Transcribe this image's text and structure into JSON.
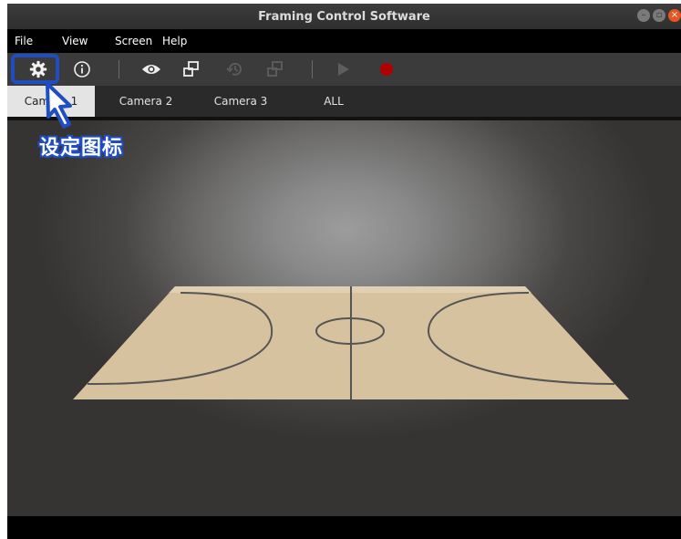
{
  "window": {
    "title": "Framing Control Software"
  },
  "menu": {
    "file": "File",
    "view": "View",
    "screen": "Screen",
    "help": "Help"
  },
  "toolbar": {
    "icons": [
      "gear-icon",
      "info-icon",
      "eye-icon",
      "windows-icon",
      "history-icon",
      "windows-disabled-icon",
      "play-icon",
      "record-icon"
    ],
    "colors": {
      "record": "#b00000",
      "disabled": "#5e5e5e",
      "enabled": "#eeeeee"
    }
  },
  "tabs": [
    {
      "label": "Camera 1",
      "active": true
    },
    {
      "label": "Camera 2",
      "active": false
    },
    {
      "label": "Camera 3",
      "active": false
    },
    {
      "label": "ALL",
      "active": false
    }
  ],
  "annotation": {
    "label": "设定图标",
    "color": "#1f4dc4"
  },
  "court": {
    "floor_color": "#d7c29f",
    "line_color": "#555555"
  }
}
